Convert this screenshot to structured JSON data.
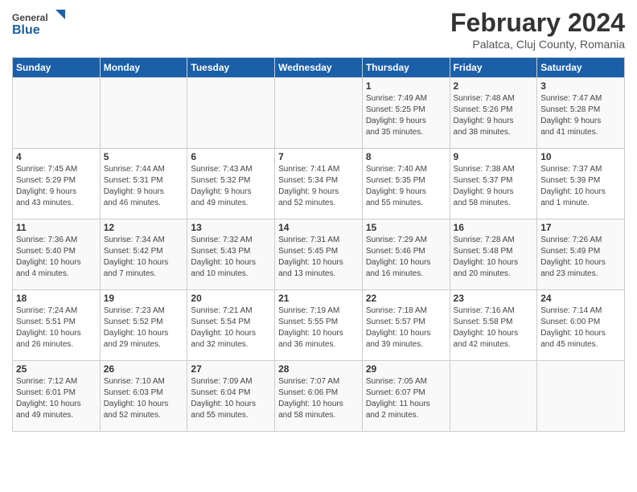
{
  "logo": {
    "general": "General",
    "blue": "Blue"
  },
  "title": {
    "month_year": "February 2024",
    "location": "Palatca, Cluj County, Romania"
  },
  "headers": [
    "Sunday",
    "Monday",
    "Tuesday",
    "Wednesday",
    "Thursday",
    "Friday",
    "Saturday"
  ],
  "weeks": [
    [
      {
        "num": "",
        "info": ""
      },
      {
        "num": "",
        "info": ""
      },
      {
        "num": "",
        "info": ""
      },
      {
        "num": "",
        "info": ""
      },
      {
        "num": "1",
        "info": "Sunrise: 7:49 AM\nSunset: 5:25 PM\nDaylight: 9 hours\nand 35 minutes."
      },
      {
        "num": "2",
        "info": "Sunrise: 7:48 AM\nSunset: 5:26 PM\nDaylight: 9 hours\nand 38 minutes."
      },
      {
        "num": "3",
        "info": "Sunrise: 7:47 AM\nSunset: 5:28 PM\nDaylight: 9 hours\nand 41 minutes."
      }
    ],
    [
      {
        "num": "4",
        "info": "Sunrise: 7:45 AM\nSunset: 5:29 PM\nDaylight: 9 hours\nand 43 minutes."
      },
      {
        "num": "5",
        "info": "Sunrise: 7:44 AM\nSunset: 5:31 PM\nDaylight: 9 hours\nand 46 minutes."
      },
      {
        "num": "6",
        "info": "Sunrise: 7:43 AM\nSunset: 5:32 PM\nDaylight: 9 hours\nand 49 minutes."
      },
      {
        "num": "7",
        "info": "Sunrise: 7:41 AM\nSunset: 5:34 PM\nDaylight: 9 hours\nand 52 minutes."
      },
      {
        "num": "8",
        "info": "Sunrise: 7:40 AM\nSunset: 5:35 PM\nDaylight: 9 hours\nand 55 minutes."
      },
      {
        "num": "9",
        "info": "Sunrise: 7:38 AM\nSunset: 5:37 PM\nDaylight: 9 hours\nand 58 minutes."
      },
      {
        "num": "10",
        "info": "Sunrise: 7:37 AM\nSunset: 5:39 PM\nDaylight: 10 hours\nand 1 minute."
      }
    ],
    [
      {
        "num": "11",
        "info": "Sunrise: 7:36 AM\nSunset: 5:40 PM\nDaylight: 10 hours\nand 4 minutes."
      },
      {
        "num": "12",
        "info": "Sunrise: 7:34 AM\nSunset: 5:42 PM\nDaylight: 10 hours\nand 7 minutes."
      },
      {
        "num": "13",
        "info": "Sunrise: 7:32 AM\nSunset: 5:43 PM\nDaylight: 10 hours\nand 10 minutes."
      },
      {
        "num": "14",
        "info": "Sunrise: 7:31 AM\nSunset: 5:45 PM\nDaylight: 10 hours\nand 13 minutes."
      },
      {
        "num": "15",
        "info": "Sunrise: 7:29 AM\nSunset: 5:46 PM\nDaylight: 10 hours\nand 16 minutes."
      },
      {
        "num": "16",
        "info": "Sunrise: 7:28 AM\nSunset: 5:48 PM\nDaylight: 10 hours\nand 20 minutes."
      },
      {
        "num": "17",
        "info": "Sunrise: 7:26 AM\nSunset: 5:49 PM\nDaylight: 10 hours\nand 23 minutes."
      }
    ],
    [
      {
        "num": "18",
        "info": "Sunrise: 7:24 AM\nSunset: 5:51 PM\nDaylight: 10 hours\nand 26 minutes."
      },
      {
        "num": "19",
        "info": "Sunrise: 7:23 AM\nSunset: 5:52 PM\nDaylight: 10 hours\nand 29 minutes."
      },
      {
        "num": "20",
        "info": "Sunrise: 7:21 AM\nSunset: 5:54 PM\nDaylight: 10 hours\nand 32 minutes."
      },
      {
        "num": "21",
        "info": "Sunrise: 7:19 AM\nSunset: 5:55 PM\nDaylight: 10 hours\nand 36 minutes."
      },
      {
        "num": "22",
        "info": "Sunrise: 7:18 AM\nSunset: 5:57 PM\nDaylight: 10 hours\nand 39 minutes."
      },
      {
        "num": "23",
        "info": "Sunrise: 7:16 AM\nSunset: 5:58 PM\nDaylight: 10 hours\nand 42 minutes."
      },
      {
        "num": "24",
        "info": "Sunrise: 7:14 AM\nSunset: 6:00 PM\nDaylight: 10 hours\nand 45 minutes."
      }
    ],
    [
      {
        "num": "25",
        "info": "Sunrise: 7:12 AM\nSunset: 6:01 PM\nDaylight: 10 hours\nand 49 minutes."
      },
      {
        "num": "26",
        "info": "Sunrise: 7:10 AM\nSunset: 6:03 PM\nDaylight: 10 hours\nand 52 minutes."
      },
      {
        "num": "27",
        "info": "Sunrise: 7:09 AM\nSunset: 6:04 PM\nDaylight: 10 hours\nand 55 minutes."
      },
      {
        "num": "28",
        "info": "Sunrise: 7:07 AM\nSunset: 6:06 PM\nDaylight: 10 hours\nand 58 minutes."
      },
      {
        "num": "29",
        "info": "Sunrise: 7:05 AM\nSunset: 6:07 PM\nDaylight: 11 hours\nand 2 minutes."
      },
      {
        "num": "",
        "info": ""
      },
      {
        "num": "",
        "info": ""
      }
    ]
  ]
}
